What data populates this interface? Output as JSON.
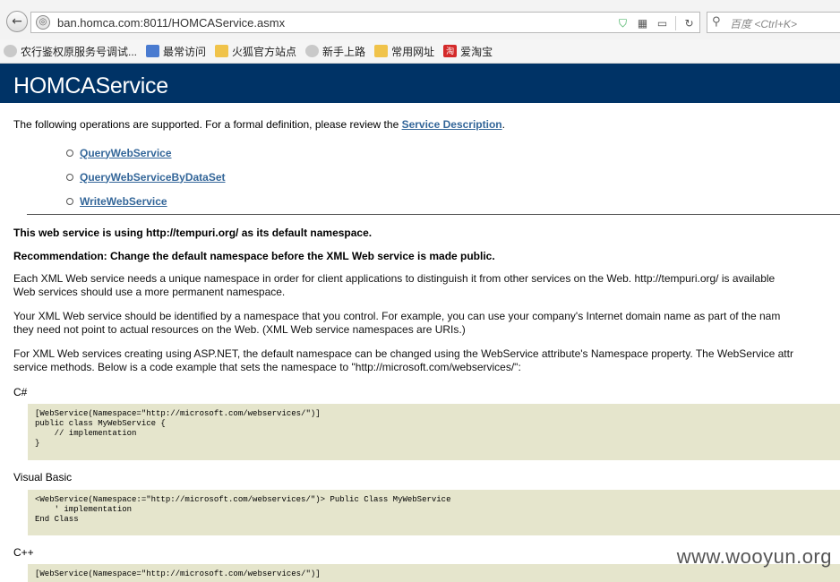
{
  "browser": {
    "url": "ban.homca.com:8011/HOMCAService.asmx",
    "search_placeholder": "百度 <Ctrl+K>",
    "bookmarks": [
      "农行鉴权原服务号调试...",
      "最常访问",
      "火狐官方站点",
      "新手上路",
      "常用网址",
      "爱淘宝"
    ]
  },
  "page": {
    "title": "HOMCAService",
    "intro_text": "The following operations are supported. For a formal definition, please review the ",
    "intro_link": "Service Description",
    "intro_end": ".",
    "operations": [
      "QueryWebService",
      "QueryWebServiceByDataSet",
      "WriteWebService"
    ],
    "namespace_notice": "This web service is using http://tempuri.org/ as its default namespace.",
    "recommendation": "Recommendation: Change the default namespace before the XML Web service is made public.",
    "para1_line1": "Each XML Web service needs a unique namespace in order for client applications to distinguish it from other services on the Web. http://tempuri.org/ is available",
    "para1_line2": "Web services should use a more permanent namespace.",
    "para2_line1": "Your XML Web service should be identified by a namespace that you control. For example, you can use your company's Internet domain name as part of the nam",
    "para2_line2": "they need not point to actual resources on the Web. (XML Web service namespaces are URIs.)",
    "para3_line1": "For XML Web services creating using ASP.NET, the default namespace can be changed using the WebService attribute's Namespace property. The WebService attr",
    "para3_line2": "service methods. Below is a code example that sets the namespace to \"http://microsoft.com/webservices/\":",
    "lang_cs": "C#",
    "code_cs": "[WebService(Namespace=\"http://microsoft.com/webservices/\")]\npublic class MyWebService {\n    // implementation\n}",
    "lang_vb": "Visual Basic",
    "code_vb": "<WebService(Namespace:=\"http://microsoft.com/webservices/\")> Public Class MyWebService\n    ' implementation\nEnd Class",
    "lang_cpp": "C++",
    "code_cpp": "[WebService(Namespace=\"http://microsoft.com/webservices/\")]"
  },
  "watermark": "www.wooyun.org"
}
